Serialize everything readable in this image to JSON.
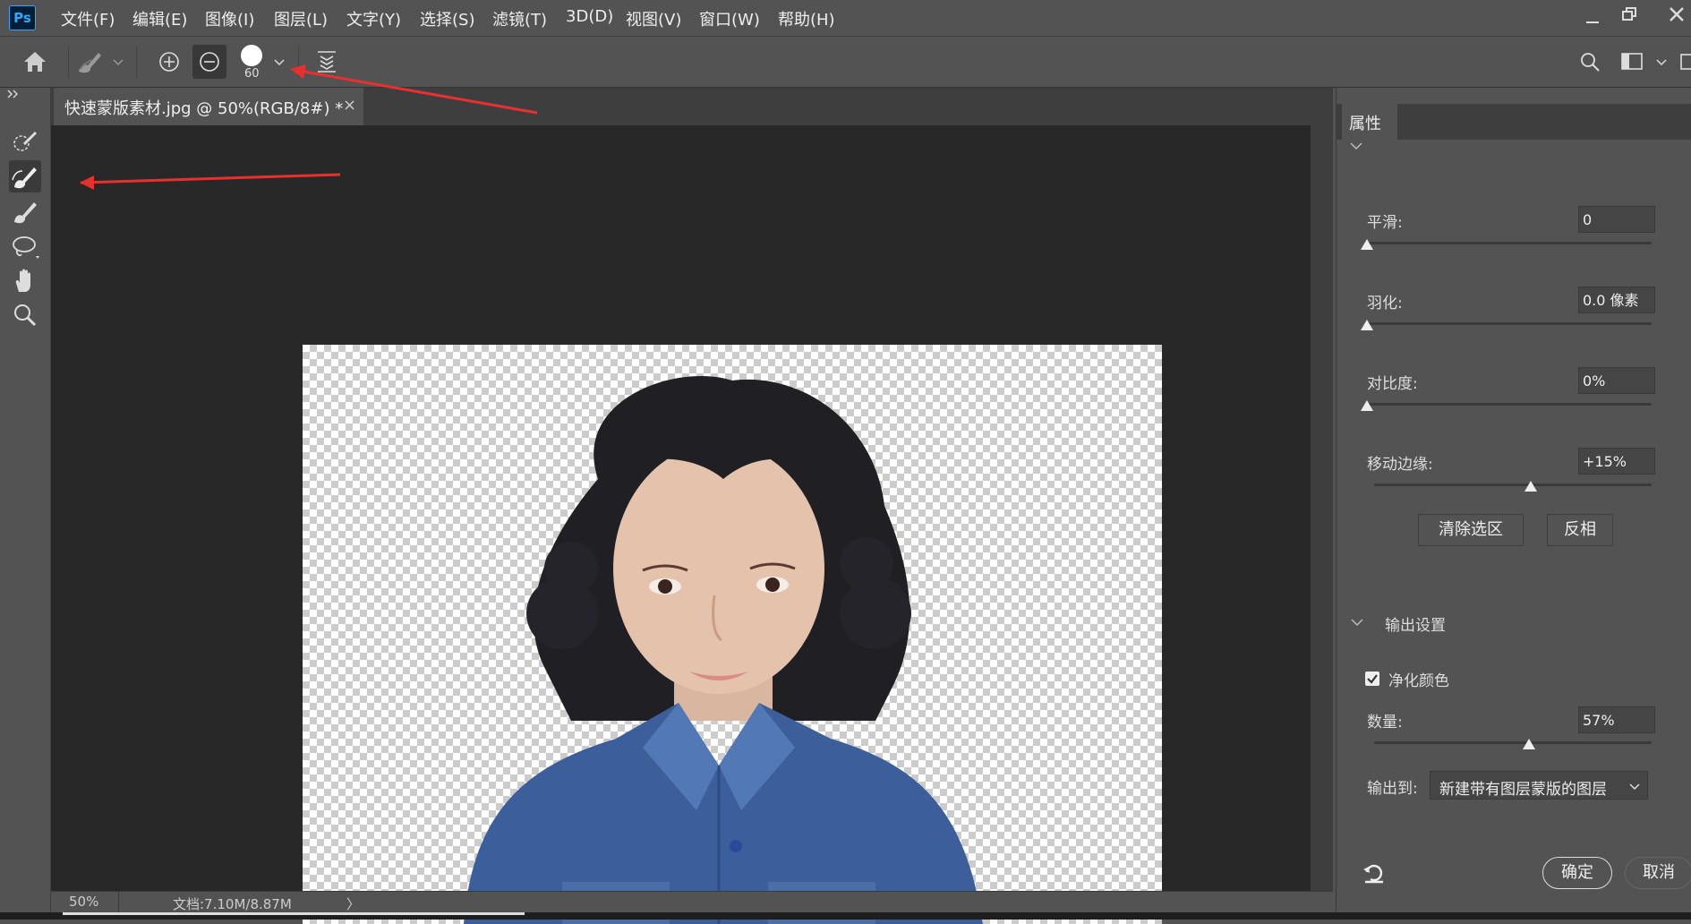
{
  "app": {
    "logo": "Ps"
  },
  "menu": [
    "文件(F)",
    "编辑(E)",
    "图像(I)",
    "图层(L)",
    "文字(Y)",
    "选择(S)",
    "滤镜(T)",
    "3D(D)",
    "视图(V)",
    "窗口(W)",
    "帮助(H)"
  ],
  "options_bar": {
    "brush_size": "60"
  },
  "document": {
    "tab_title": "快速蒙版素材.jpg @ 50%(RGB/8#) *",
    "close_glyph": "×"
  },
  "status": {
    "zoom": "50%",
    "doc_info": "文档:7.10M/8.87M",
    "arrow": "〉"
  },
  "panel": {
    "tab": "属性",
    "smooth": {
      "label": "平滑:",
      "value": "0",
      "slider": 0
    },
    "feather": {
      "label": "羽化:",
      "value": "0.0 像素",
      "slider": 0
    },
    "contrast": {
      "label": "对比度:",
      "value": "0%",
      "slider": 0
    },
    "shift_edge": {
      "label": "移动边缘:",
      "value": "+15%",
      "slider": 0.575
    },
    "clear_selection": "清除选区",
    "invert": "反相",
    "output_section": "输出设置",
    "decontaminate": {
      "label": "净化颜色",
      "checked": true
    },
    "amount": {
      "label": "数量:",
      "value": "57%",
      "slider": 0.57
    },
    "output_to": {
      "label": "输出到:",
      "value": "新建带有图层蒙版的图层"
    },
    "ok": "确定",
    "cancel": "取消"
  },
  "colors": {
    "accent_arrow": "#e8302e",
    "ps_blue": "#31a8ff"
  }
}
